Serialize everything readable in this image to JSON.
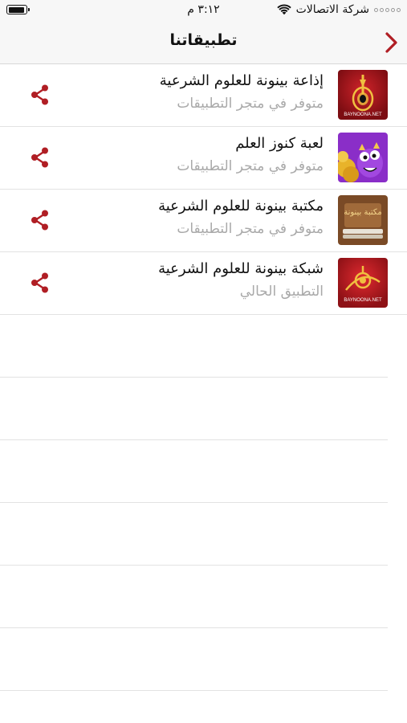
{
  "status_bar": {
    "carrier": "شركة الاتصالات",
    "time": "٣:١٢ م",
    "battery_level": 0.95
  },
  "nav": {
    "title": "تطبيقاتنا",
    "back_icon": "chevron-right-icon"
  },
  "apps": [
    {
      "title": "إذاعة بينونة للعلوم الشرعية",
      "subtitle": "متوفر في متجر التطبيقات",
      "icon": "radio-app-icon",
      "icon_caption": "BAYNOONA.NET"
    },
    {
      "title": "لعبة كنوز العلم",
      "subtitle": "متوفر في متجر التطبيقات",
      "icon": "game-app-icon"
    },
    {
      "title": "مكتبة بينونة للعلوم الشرعية",
      "subtitle": "متوفر في متجر التطبيقات",
      "icon": "library-app-icon",
      "icon_caption": "مكتبة بينونة"
    },
    {
      "title": "شبكة بينونة للعلوم الشرعية",
      "subtitle": "التطبيق الحالي",
      "icon": "network-app-icon",
      "icon_caption": "BAYNOONA.NET"
    }
  ],
  "colors": {
    "accent": "#b01e24",
    "subtitle": "#a9a9a9",
    "separator": "#e2e2e2",
    "bar_bg": "#f7f7f7"
  }
}
